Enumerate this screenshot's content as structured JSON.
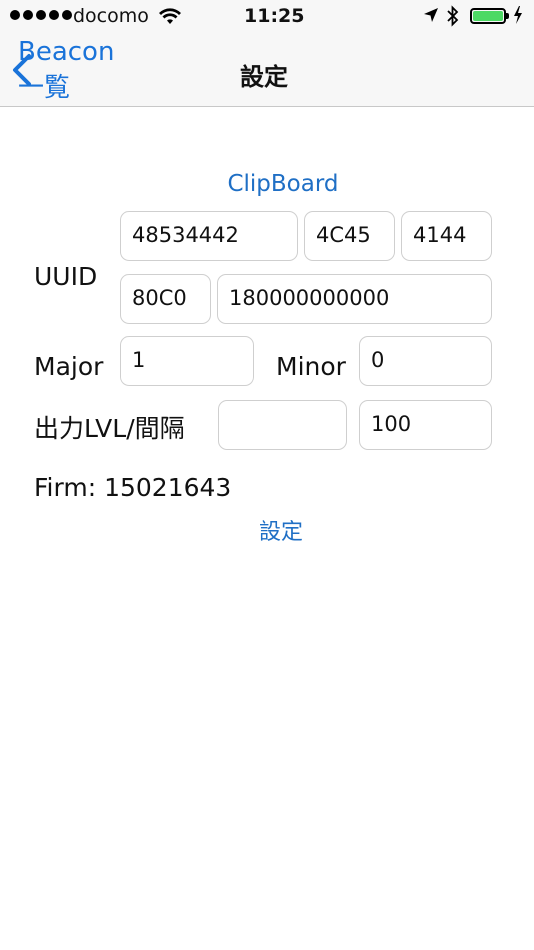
{
  "status_bar": {
    "carrier": "docomo",
    "time": "11:25",
    "signal_bars": 5,
    "battery_level": 1.0,
    "icons": [
      "signal-dots-icon",
      "wifi-icon",
      "location-arrow-icon",
      "bluetooth-icon",
      "battery-icon",
      "charging-bolt-icon"
    ]
  },
  "nav": {
    "back_label": "Beacon一覧",
    "title": "設定"
  },
  "clipboard_label": "ClipBoard",
  "uuid": {
    "label": "UUID",
    "part1": "48534442",
    "part2": "4C45",
    "part3": "4144",
    "part4": "80C0",
    "part5": "180000000000"
  },
  "major": {
    "label": "Major",
    "value": "1"
  },
  "minor": {
    "label": "Minor",
    "value": "0"
  },
  "output": {
    "label": "出力LVL/間隔",
    "level_value": "",
    "interval_value": "100"
  },
  "firm_text": "Firm: 15021643",
  "set_button_label": "設定",
  "colors": {
    "accent": "#1f6fc5",
    "battery": "#4cd964"
  }
}
